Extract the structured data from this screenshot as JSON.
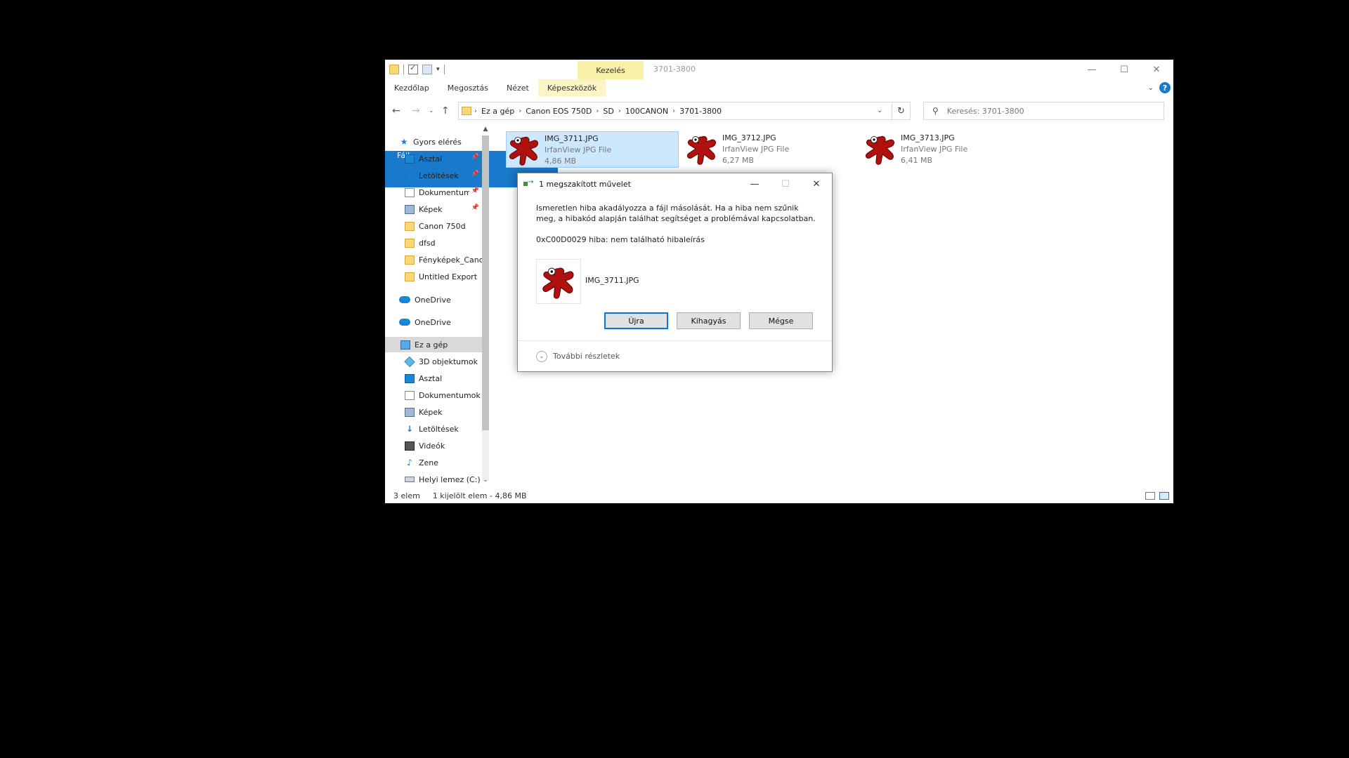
{
  "window": {
    "title": "3701-3800",
    "context_tab": "Kezelés"
  },
  "ribbon": {
    "tabs": [
      "Fájl",
      "Kezdőlap",
      "Megosztás",
      "Nézet",
      "Képeszközök"
    ],
    "help": "?"
  },
  "address": {
    "crumbs": [
      "Ez a gép",
      "Canon EOS 750D",
      "SD",
      "100CANON",
      "3701-3800"
    ]
  },
  "search": {
    "placeholder": "Keresés: 3701-3800"
  },
  "sidebar": {
    "items": [
      {
        "label": "Gyors elérés",
        "icon": "star-icon"
      },
      {
        "label": "Asztal",
        "icon": "desktop-icon"
      },
      {
        "label": "Letöltések",
        "icon": "download-icon"
      },
      {
        "label": "Dokumentumok",
        "icon": "document-icon"
      },
      {
        "label": "Képek",
        "icon": "pictures-icon"
      },
      {
        "label": "Canon 750d",
        "icon": "folder-icon"
      },
      {
        "label": "dfsd",
        "icon": "folder-icon"
      },
      {
        "label": "Fényképek_Canon",
        "icon": "folder-icon"
      },
      {
        "label": "Untitled Export",
        "icon": "folder-icon"
      },
      {
        "label": "OneDrive",
        "icon": "cloud-icon"
      },
      {
        "label": "OneDrive",
        "icon": "cloud-icon"
      },
      {
        "label": "Ez a gép",
        "icon": "computer-icon"
      },
      {
        "label": "3D objektumok",
        "icon": "cube-icon"
      },
      {
        "label": "Asztal",
        "icon": "desktop-icon"
      },
      {
        "label": "Dokumentumok",
        "icon": "document-icon"
      },
      {
        "label": "Képek",
        "icon": "pictures-icon"
      },
      {
        "label": "Letöltések",
        "icon": "download-icon"
      },
      {
        "label": "Videók",
        "icon": "video-icon"
      },
      {
        "label": "Zene",
        "icon": "music-icon"
      },
      {
        "label": "Helyi lemez (C:)",
        "icon": "drive-icon"
      }
    ]
  },
  "files": [
    {
      "name": "IMG_3711.JPG",
      "type": "IrfanView JPG File",
      "size": "4,86 MB"
    },
    {
      "name": "IMG_3712.JPG",
      "type": "IrfanView JPG File",
      "size": "6,27 MB"
    },
    {
      "name": "IMG_3713.JPG",
      "type": "IrfanView JPG File",
      "size": "6,41 MB"
    }
  ],
  "status": {
    "count": "3 elem",
    "selection": "1 kijelölt elem - 4,86 MB"
  },
  "dialog": {
    "title": "1 megszakított művelet",
    "message": "Ismeretlen hiba akadályozza a fájl másolását. Ha a hiba nem szűnik meg, a hibakód alapján találhat segítséget a problémával kapcsolatban.",
    "error": "0xC00D0029 hiba: nem található hibaleírás",
    "file": "IMG_3711.JPG",
    "buttons": {
      "retry": "Újra",
      "skip": "Kihagyás",
      "cancel": "Mégse"
    },
    "more": "További részletek"
  },
  "colors": {
    "accent": "#1979ca",
    "selection": "#cce8ff",
    "context_tab": "#f9f0a8",
    "irfan_red": "#b0100e"
  }
}
